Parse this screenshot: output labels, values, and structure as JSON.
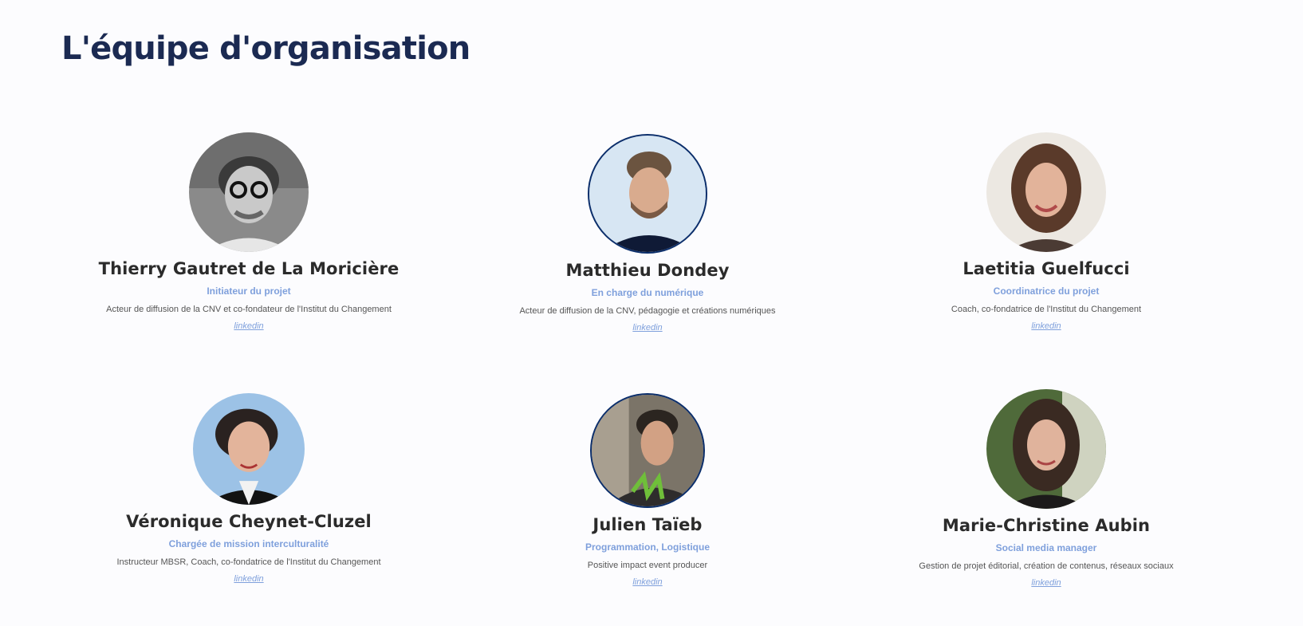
{
  "page": {
    "title": "L'équipe d'organisation"
  },
  "team": [
    {
      "name": "Thierry Gautret de La Moricière",
      "role": "Initiateur du projet",
      "description": "Acteur de diffusion de la CNV et co-fondateur de l'Institut du Changement",
      "link": "linkedin",
      "photo_icon": "portrait-photo"
    },
    {
      "name": "Matthieu Dondey",
      "role": "En charge du numérique",
      "description": "Acteur de diffusion de la CNV, pédagogie et créations numériques",
      "link": "linkedin",
      "photo_icon": "portrait-photo"
    },
    {
      "name": "Laetitia Guelfucci",
      "role": "Coordinatrice du projet",
      "description": "Coach, co-fondatrice de l'Institut du Changement",
      "link": "linkedin",
      "photo_icon": "portrait-photo"
    },
    {
      "name": "Véronique Cheynet-Cluzel",
      "role": "Chargée de mission interculturalité",
      "description": "Instructeur MBSR, Coach, co-fondatrice de l'Institut du Changement",
      "link": "linkedin",
      "photo_icon": "portrait-photo"
    },
    {
      "name": "Julien Taïeb",
      "role": "Programmation, Logistique",
      "description": "Positive impact event producer",
      "link": "linkedin",
      "photo_icon": "portrait-photo"
    },
    {
      "name": "Marie-Christine Aubin",
      "role": "Social media manager",
      "description": "Gestion de projet éditorial, création de contenus, réseaux sociaux",
      "link": "linkedin",
      "photo_icon": "portrait-photo"
    }
  ],
  "colors": {
    "title": "#1b2a52",
    "accent": "#7fa0dc",
    "name": "#2b2b2b",
    "background": "#fcfcfe"
  }
}
